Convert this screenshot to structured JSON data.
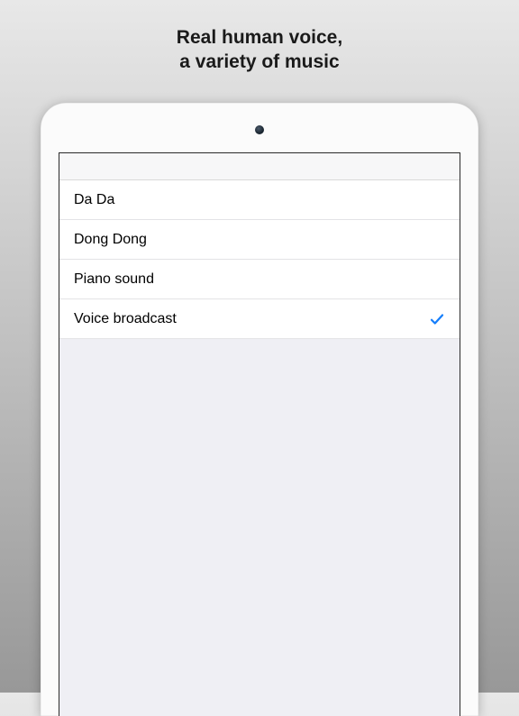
{
  "headline": {
    "line1": "Real human voice,",
    "line2": "a variety of music"
  },
  "list": {
    "items": [
      {
        "label": "Da Da",
        "selected": false
      },
      {
        "label": "Dong Dong",
        "selected": false
      },
      {
        "label": "Piano sound",
        "selected": false
      },
      {
        "label": "Voice broadcast",
        "selected": true
      }
    ]
  },
  "icons": {
    "checkmark": "checkmark-icon"
  },
  "colors": {
    "accent": "#157efb"
  }
}
